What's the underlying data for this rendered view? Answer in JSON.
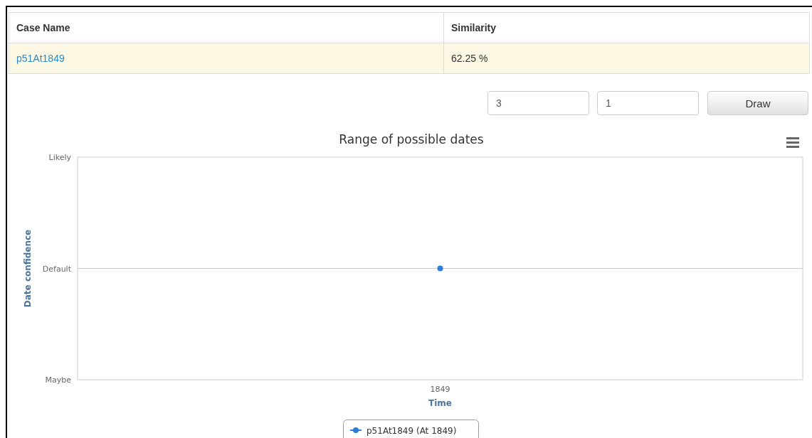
{
  "table": {
    "columns": [
      "Case Name",
      "Similarity"
    ],
    "rows": [
      {
        "case_name": "p51At1849",
        "similarity": "62.25 %"
      }
    ]
  },
  "controls": {
    "fields": [
      {
        "value": "3"
      },
      {
        "value": "1"
      }
    ],
    "button": "Draw"
  },
  "chart": {
    "title": "Range of possible dates",
    "y_axis_title": "Date confidence",
    "y_labels": [
      "Likely",
      "Default",
      "Maybe"
    ],
    "x_labels": [
      "1849"
    ],
    "x_axis_title": "Time",
    "legend": [
      {
        "label": "p51At1849 (At 1849)",
        "color": "#2f7ed8"
      }
    ]
  }
}
